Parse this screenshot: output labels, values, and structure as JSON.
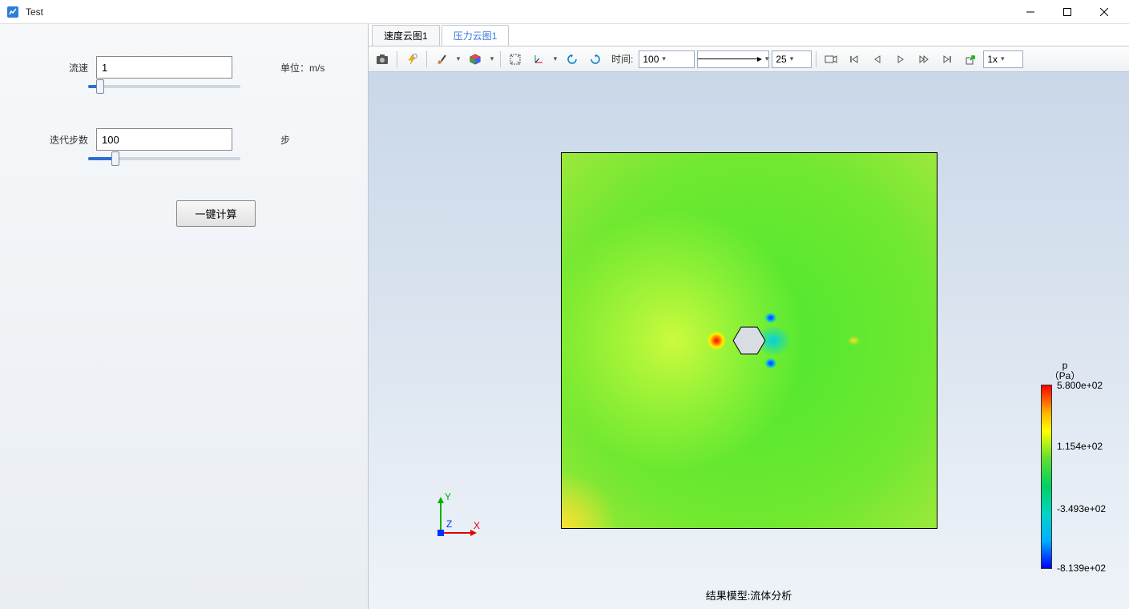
{
  "window": {
    "title": "Test"
  },
  "form": {
    "flow_label": "流速",
    "flow_value": "1",
    "flow_unit": "单位：m/s",
    "steps_label": "迭代步数",
    "steps_value": "100",
    "steps_unit": "步",
    "calc_button": "一键计算"
  },
  "tabs": {
    "velocity": "速度云图1",
    "pressure": "压力云图1"
  },
  "toolbar": {
    "time_label": "时间:",
    "time_value": "100",
    "fps_value": "25",
    "speed_value": "1x"
  },
  "legend": {
    "title_line1": "p",
    "title_line2": "（Pa）",
    "ticks": [
      "5.800e+02",
      "1.154e+02",
      "-3.493e+02",
      "-8.139e+02"
    ]
  },
  "status": "结果模型:流体分析",
  "axes": {
    "x": "X",
    "y": "Y",
    "z": "Z"
  }
}
